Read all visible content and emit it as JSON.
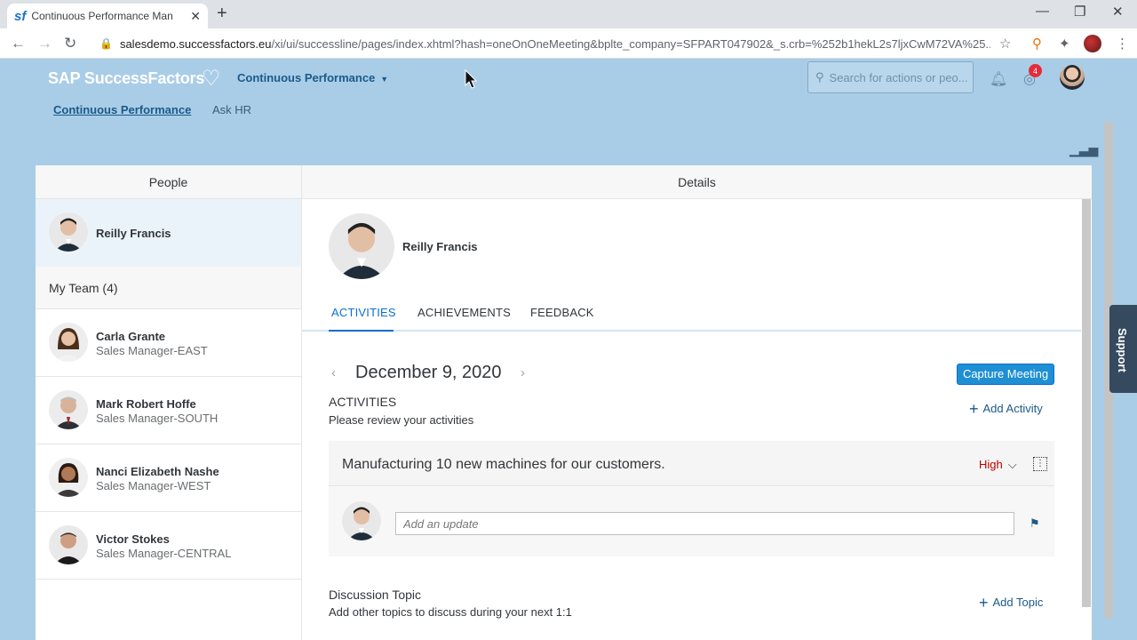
{
  "browser": {
    "tab_title": "Continuous Performance Manag",
    "favicon": "sf",
    "url_host": "salesdemo.successfactors.eu",
    "url_rest": "/xi/ui/successline/pages/index.xhtml?hash=oneOnOneMeeting&bplte_company=SFPART047902&_s.crb=%252b1hekL2s7ljxCwM72VA%25..."
  },
  "header": {
    "logo": "SAP SuccessFactors",
    "module": "Continuous Performance",
    "search_placeholder": "Search for actions or peo...",
    "notification_count": "4",
    "subnav": [
      "Continuous Performance",
      "Ask HR"
    ]
  },
  "panel": {
    "people_header": "People",
    "details_header": "Details"
  },
  "people": {
    "me": {
      "name": "Reilly Francis"
    },
    "team_label": "My Team (4)",
    "team": [
      {
        "name": "Carla Grante",
        "role": "Sales Manager-EAST"
      },
      {
        "name": "Mark Robert Hoffe",
        "role": "Sales Manager-SOUTH"
      },
      {
        "name": "Nanci Elizabeth Nashe",
        "role": "Sales Manager-WEST"
      },
      {
        "name": "Victor Stokes",
        "role": "Sales Manager-CENTRAL"
      }
    ]
  },
  "details": {
    "name": "Reilly Francis",
    "tabs": [
      "ACTIVITIES",
      "ACHIEVEMENTS",
      "FEEDBACK"
    ],
    "date": "December 9, 2020",
    "capture_button": "Capture Meeting",
    "activities_title": "ACTIVITIES",
    "activities_sub": "Please review your activities",
    "add_activity": "Add Activity",
    "activity": {
      "title": "Manufacturing 10 new machines for our customers.",
      "priority": "High",
      "update_placeholder": "Add an update"
    },
    "discussion_title": "Discussion Topic",
    "discussion_sub": "Add other topics to discuss during your next 1:1",
    "add_topic": "Add Topic"
  },
  "support": "Support",
  "colors": {
    "accent": "#0a6ed1",
    "shell_bg": "#a9cde7",
    "priority_high": "#bb0000",
    "button": "#1f8fd3"
  },
  "icons": [
    "back-icon",
    "forward-icon",
    "reload-icon",
    "lock-icon",
    "star-icon",
    "extensions-icon",
    "heart-icon",
    "search-icon",
    "bell-icon",
    "notifications-icon",
    "chart-icon",
    "chevron-left-icon",
    "chevron-right-icon",
    "plus-icon",
    "chevron-down-icon",
    "more-icon",
    "flag-icon"
  ]
}
